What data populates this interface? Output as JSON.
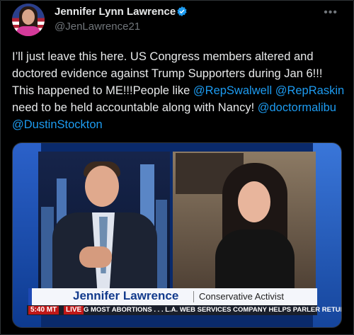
{
  "author": {
    "name": "Jennifer Lynn Lawrence",
    "handle": "@JenLawrence21"
  },
  "tweet": {
    "text_1": "I’ll just leave this here. US Congress members altered and doctored evidence against Trump Supporters during Jan 6!!! This happened to ME!!!People like ",
    "mention_1": "@RepSwalwell",
    "text_2": " ",
    "mention_2": "@RepRaskin",
    "text_3": " need to be held accountable along with Nancy! ",
    "mention_3": "@doctormalibu",
    "text_4": " ",
    "mention_4": "@DustinStockton"
  },
  "video": {
    "lower_third_name": "Jennifer Lawrence",
    "lower_third_title": "Conservative Activist",
    "ticker_time": "5:40 MT",
    "ticker_live": "LIVE",
    "ticker_text": "G MOST ABORTIONS . . .     L.A. WEB SERVICES COMPANY HELPS PARLER RETURN ONLI"
  },
  "icons": {
    "verified": "verified-badge-icon",
    "more": "more-options-icon"
  },
  "colors": {
    "link": "#1d9bf0",
    "text": "#e7e9ea",
    "muted": "#71767b",
    "background": "#000000"
  }
}
